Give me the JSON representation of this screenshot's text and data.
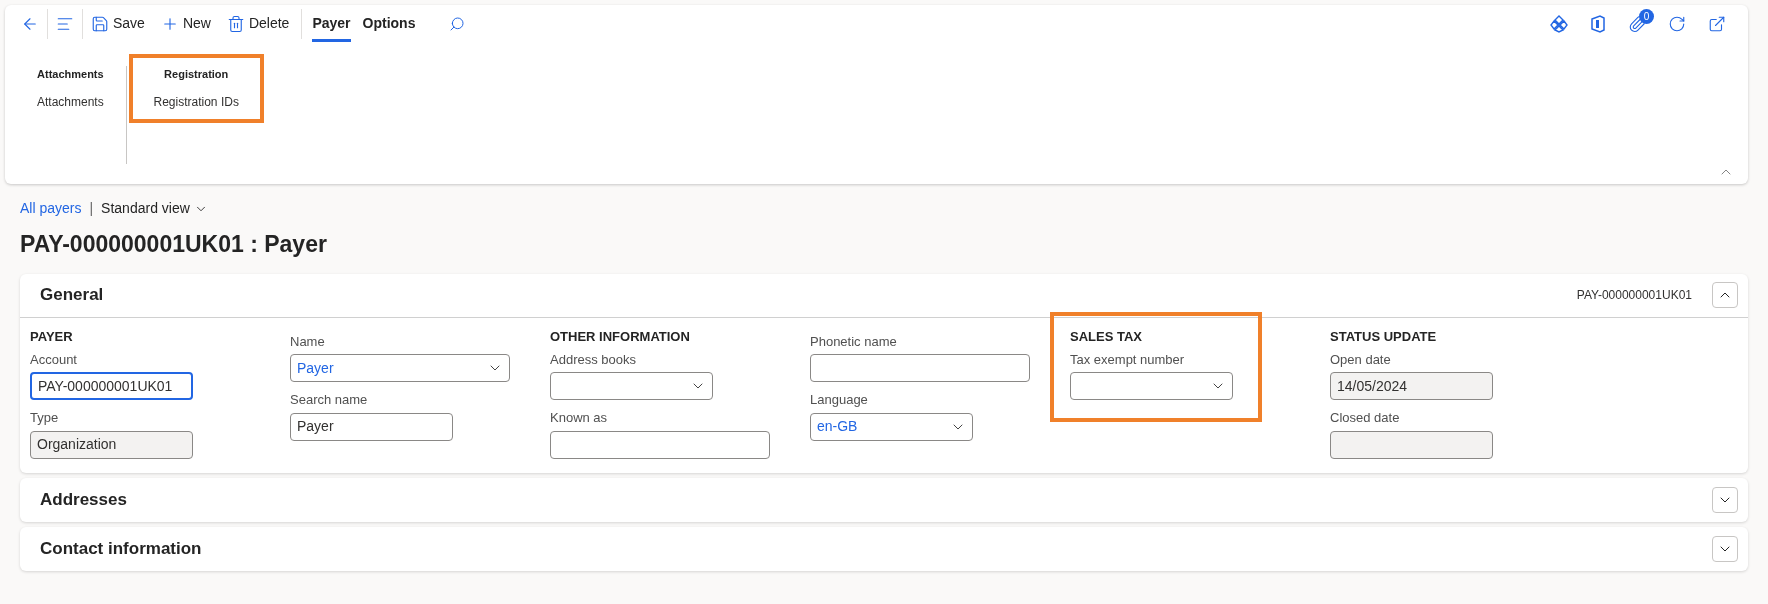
{
  "toolbar": {
    "actions": [
      {
        "kind": "back"
      },
      {
        "kind": "menu"
      },
      {
        "kind": "save",
        "label": "Save"
      },
      {
        "kind": "new",
        "label": "New"
      },
      {
        "kind": "delete",
        "label": "Delete"
      }
    ],
    "tabs": [
      {
        "label": "Payer",
        "selected": true
      },
      {
        "label": "Options",
        "selected": false
      }
    ],
    "right_icons": [
      {
        "kind": "diamond"
      },
      {
        "kind": "office"
      },
      {
        "kind": "attach",
        "badge": "0"
      },
      {
        "kind": "refresh"
      },
      {
        "kind": "popout"
      }
    ],
    "groups": [
      {
        "title": "Attachments",
        "items": [
          "Attachments"
        ],
        "highlighted": false
      },
      {
        "title": "Registration",
        "items": [
          "Registration IDs"
        ],
        "highlighted": true
      }
    ]
  },
  "breadcrumb": {
    "link": "All payers",
    "separator": "|",
    "view": "Standard view"
  },
  "title": "PAY-000000001UK01 : Payer",
  "sections": [
    {
      "title": "General",
      "expanded": true,
      "summary": "PAY-000000001UK01",
      "columns": [
        {
          "heading": "PAYER",
          "highlighted": false,
          "fields": [
            {
              "label": "Account",
              "kind": "text",
              "value": "PAY-000000001UK01",
              "readonly": false,
              "focused": true
            },
            {
              "label": "Type",
              "kind": "text",
              "value": "Organization",
              "readonly": true,
              "focused": false
            }
          ]
        },
        {
          "fields": [
            {
              "label": "Name",
              "kind": "select",
              "value": "Payer",
              "wide": true,
              "readonly": false,
              "focused": false
            },
            {
              "label": "Search name",
              "kind": "text",
              "value": "Payer",
              "readonly": false,
              "focused": false
            }
          ]
        },
        {
          "heading": "OTHER INFORMATION",
          "highlighted": false,
          "fields": [
            {
              "label": "Address books",
              "kind": "select",
              "readonly": false,
              "focused": false
            },
            {
              "label": "Known as",
              "kind": "text",
              "wide": true,
              "readonly": false,
              "focused": false
            }
          ]
        },
        {
          "fields": [
            {
              "label": "Phonetic name",
              "kind": "text",
              "wide": true,
              "readonly": false,
              "focused": false
            },
            {
              "label": "Language",
              "kind": "select",
              "value": "en-GB",
              "readonly": false,
              "focused": false
            }
          ]
        },
        {
          "heading": "SALES TAX",
          "highlighted": true,
          "fields": [
            {
              "label": "Tax exempt number",
              "kind": "select",
              "readonly": false,
              "focused": false
            }
          ]
        },
        {
          "heading": "STATUS UPDATE",
          "highlighted": false,
          "fields": [
            {
              "label": "Open date",
              "kind": "text",
              "value": "14/05/2024",
              "readonly": true,
              "focused": false
            },
            {
              "label": "Closed date",
              "kind": "text",
              "readonly": true,
              "focused": false
            }
          ]
        }
      ]
    },
    {
      "title": "Addresses",
      "expanded": false
    },
    {
      "title": "Contact information",
      "expanded": false
    }
  ]
}
